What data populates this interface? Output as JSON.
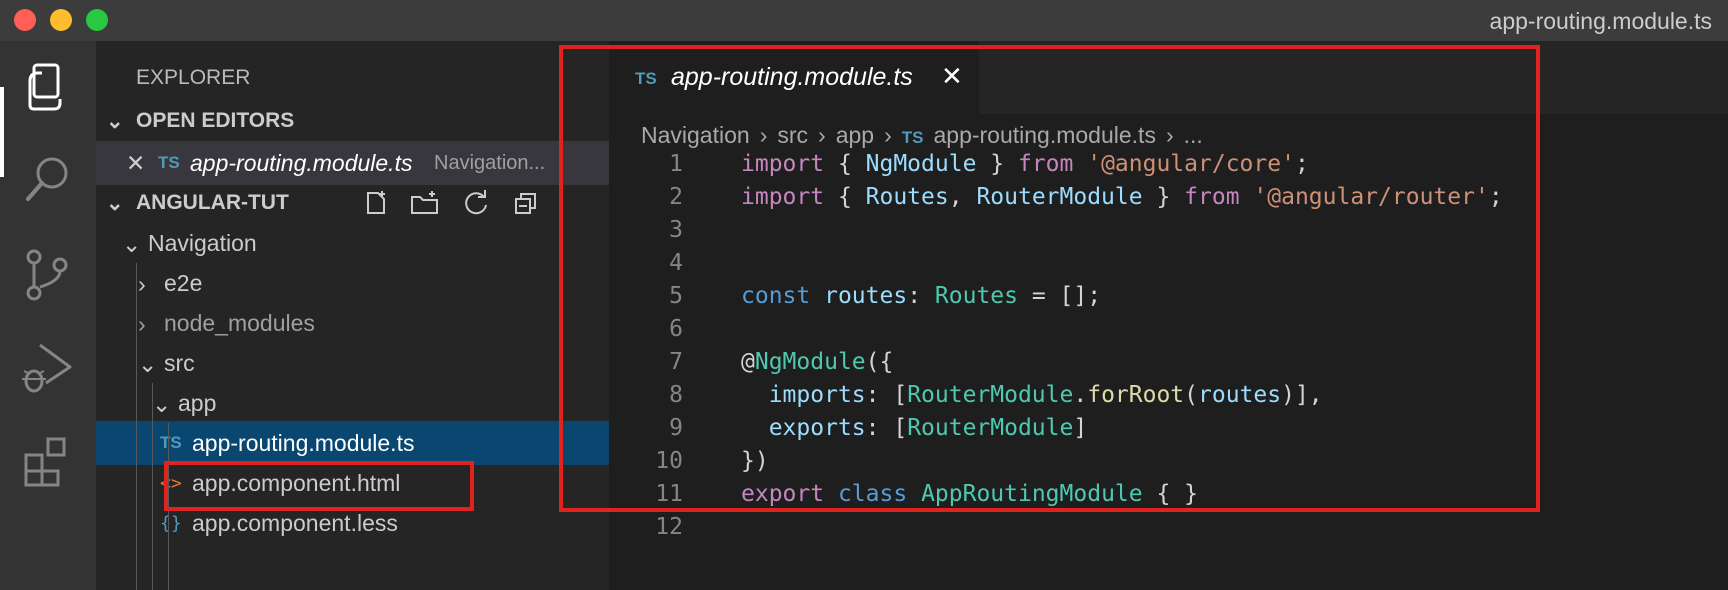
{
  "window": {
    "title": "app-routing.module.ts"
  },
  "sidebar": {
    "title": "EXPLORER",
    "open_editors": {
      "header": "OPEN EDITORS",
      "items": [
        {
          "close": "✕",
          "badge": "TS",
          "name": "app-routing.module.ts",
          "path": "Navigation..."
        }
      ]
    },
    "workspace": {
      "header": "ANGULAR-TUT",
      "tree": [
        {
          "label": "Navigation",
          "chev": "⌄",
          "expanded": true
        },
        {
          "label": "e2e",
          "chev": "›"
        },
        {
          "label": "node_modules",
          "chev": "›"
        },
        {
          "label": "src",
          "chev": "⌄",
          "expanded": true
        },
        {
          "label": "app",
          "chev": "⌄",
          "expanded": true
        },
        {
          "label": "app-routing.module.ts",
          "badge": "TS",
          "selected": true
        },
        {
          "label": "app.component.html",
          "badge": "<>"
        },
        {
          "label": "app.component.less",
          "badge": "{}"
        }
      ]
    }
  },
  "editor": {
    "tab": {
      "badge": "TS",
      "name": "app-routing.module.ts",
      "close": "✕"
    },
    "breadcrumb": [
      "Navigation",
      "src",
      "app",
      "TS",
      "app-routing.module.ts",
      "..."
    ],
    "breadcrumb_sep": "›",
    "lines": [
      {
        "n": "1",
        "tokens": [
          [
            "kw",
            "import"
          ],
          [
            "pn",
            " { "
          ],
          [
            "id",
            "NgModule"
          ],
          [
            "pn",
            " } "
          ],
          [
            "kw",
            "from"
          ],
          [
            "pn",
            " "
          ],
          [
            "st",
            "'@angular/core'"
          ],
          [
            "pn",
            ";"
          ]
        ]
      },
      {
        "n": "2",
        "tokens": [
          [
            "kw",
            "import"
          ],
          [
            "pn",
            " { "
          ],
          [
            "id",
            "Routes"
          ],
          [
            "pn",
            ", "
          ],
          [
            "id",
            "RouterModule"
          ],
          [
            "pn",
            " } "
          ],
          [
            "kw",
            "from"
          ],
          [
            "pn",
            " "
          ],
          [
            "st",
            "'@angular/router'"
          ],
          [
            "pn",
            ";"
          ]
        ]
      },
      {
        "n": "3",
        "tokens": []
      },
      {
        "n": "4",
        "tokens": []
      },
      {
        "n": "5",
        "tokens": [
          [
            "kw2",
            "const"
          ],
          [
            "pn",
            " "
          ],
          [
            "id",
            "routes"
          ],
          [
            "pn",
            ": "
          ],
          [
            "ty",
            "Routes"
          ],
          [
            "pn",
            " = [];"
          ]
        ]
      },
      {
        "n": "6",
        "tokens": []
      },
      {
        "n": "7",
        "tokens": [
          [
            "pn",
            "@"
          ],
          [
            "ty",
            "NgModule"
          ],
          [
            "pn",
            "({"
          ]
        ]
      },
      {
        "n": "8",
        "tokens": [
          [
            "pn",
            "  "
          ],
          [
            "id",
            "imports"
          ],
          [
            "pn",
            ": ["
          ],
          [
            "ty",
            "RouterModule"
          ],
          [
            "pn",
            "."
          ],
          [
            "fn",
            "forRoot"
          ],
          [
            "pn",
            "("
          ],
          [
            "id",
            "routes"
          ],
          [
            "pn",
            ")],"
          ]
        ]
      },
      {
        "n": "9",
        "tokens": [
          [
            "pn",
            "  "
          ],
          [
            "id",
            "exports"
          ],
          [
            "pn",
            ": ["
          ],
          [
            "ty",
            "RouterModule"
          ],
          [
            "pn",
            "]"
          ]
        ]
      },
      {
        "n": "10",
        "tokens": [
          [
            "pn",
            "})"
          ]
        ]
      },
      {
        "n": "11",
        "tokens": [
          [
            "kw",
            "export"
          ],
          [
            "pn",
            " "
          ],
          [
            "kw2",
            "class"
          ],
          [
            "pn",
            " "
          ],
          [
            "ty",
            "AppRoutingModule"
          ],
          [
            "pn",
            " { }"
          ]
        ]
      },
      {
        "n": "12",
        "tokens": []
      }
    ]
  },
  "colors": {
    "highlight_border": "#e0231e",
    "selection": "#094771",
    "ts_badge": "#519aba"
  }
}
